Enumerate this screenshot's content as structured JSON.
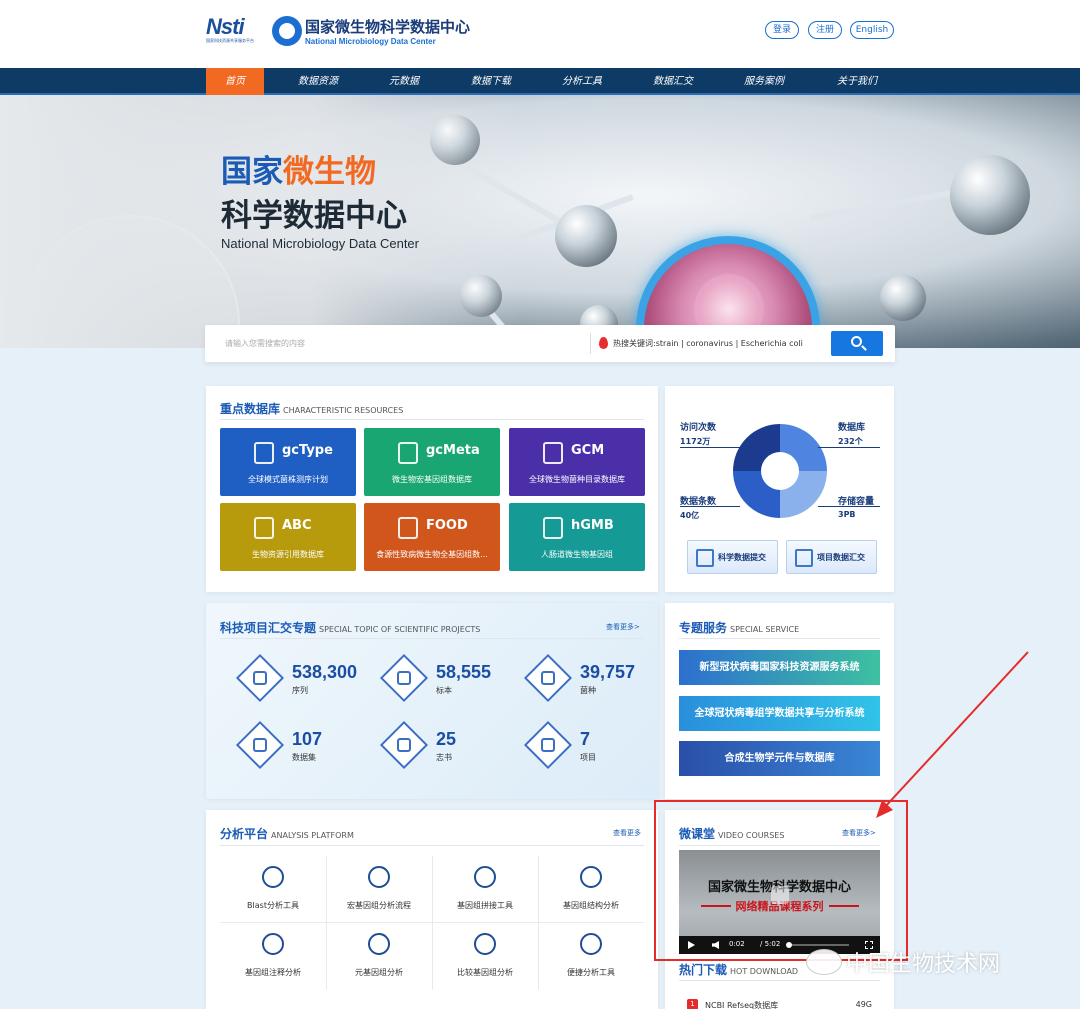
{
  "header": {
    "logo_text": "Nsti",
    "logo_sub": "国家科技资源共享服务平台",
    "title": "国家微生物科学数据中心",
    "subtitle": "National Microbiology Data Center",
    "buttons": {
      "login": "登录",
      "register": "注册",
      "english": "English"
    }
  },
  "nav": {
    "items": [
      "首页",
      "数据资源",
      "元数据",
      "数据下载",
      "分析工具",
      "数据汇交",
      "服务案例",
      "关于我们"
    ],
    "active": "首页"
  },
  "banner": {
    "title_part1": "国家",
    "title_highlight": "微生物",
    "title_line2": "科学数据中心",
    "title_en": "National  Microbiology Data Center"
  },
  "search": {
    "placeholder": "请输入您需搜索的内容",
    "hot_keywords": "热搜关键词:strain | coronavirus | Escherichia coli"
  },
  "resources": {
    "title": "重点数据库",
    "title_en": "CHARACTERISTIC RESOURCES",
    "tiles": [
      {
        "name": "gcType",
        "desc": "全球模式菌株测序计划",
        "icon": "flask-icon",
        "color": "#1f5fc4"
      },
      {
        "name": "gcMeta",
        "desc": "微生物宏基因组数据库",
        "icon": "molecule-icon",
        "color": "#1aa673"
      },
      {
        "name": "GCM",
        "desc": "全球微生物菌种目录数据库",
        "icon": "virus-icon",
        "color": "#4a2fa8"
      },
      {
        "name": "ABC",
        "desc": "生物资源引用数据库",
        "icon": "chart-icon",
        "color": "#b89a0d"
      },
      {
        "name": "FOOD",
        "desc": "食源性致病微生物全基因组数...",
        "icon": "gear-icon",
        "color": "#d0561c"
      },
      {
        "name": "hGMB",
        "desc": "人肠道微生物基因组",
        "icon": "bacteria-icon",
        "color": "#159a96"
      }
    ]
  },
  "stats": {
    "visits_label": "访问次数",
    "visits_value": "1172万",
    "databases_label": "数据库",
    "databases_value": "232个",
    "records_label": "数据条数",
    "records_value": "40亿",
    "storage_label": "存储容量",
    "storage_value": "3PB",
    "btn_submit": "科学数据提交",
    "btn_project": "项目数据汇交"
  },
  "projects": {
    "title": "科技项目汇交专题",
    "title_en": "SPECIAL TOPIC OF SCIENTIFIC PROJECTS",
    "more": "查看更多>",
    "items": [
      {
        "value": "538,300",
        "label": "序列",
        "icon": "list-icon"
      },
      {
        "value": "58,555",
        "label": "标本",
        "icon": "flask-icon"
      },
      {
        "value": "39,757",
        "label": "菌种",
        "icon": "bacteria-icon"
      },
      {
        "value": "107",
        "label": "数据集",
        "icon": "database-icon"
      },
      {
        "value": "25",
        "label": "志书",
        "icon": "book-icon"
      },
      {
        "value": "7",
        "label": "项目",
        "icon": "document-icon"
      }
    ]
  },
  "special_service": {
    "title": "专题服务",
    "title_en": "SPECIAL SERVICE",
    "items": [
      {
        "label": "新型冠状病毒国家科技资源服务系统",
        "color": "#2d6fd0"
      },
      {
        "label": "全球冠状病毒组学数据共享与分析系统",
        "color": "#27a7e0"
      },
      {
        "label": "合成生物学元件与数据库",
        "color": "#2a55b0"
      }
    ]
  },
  "analysis": {
    "title": "分析平台",
    "title_en": "ANALYSIS PLATFORM",
    "more": "查看更多",
    "tools": [
      {
        "label": "Blast分析工具",
        "icon": "dna-search-icon"
      },
      {
        "label": "宏基因组分析流程",
        "icon": "petri-dish-icon"
      },
      {
        "label": "基因组拼接工具",
        "icon": "molecule-icon"
      },
      {
        "label": "基因组结构分析",
        "icon": "flask-icon"
      },
      {
        "label": "基因组注释分析",
        "icon": "virus-icon"
      },
      {
        "label": "元基因组分析",
        "icon": "cells-icon"
      },
      {
        "label": "比较基因组分析",
        "icon": "bacteria-icon"
      },
      {
        "label": "便捷分析工具",
        "icon": "tools-icon"
      }
    ]
  },
  "video": {
    "title": "微课堂",
    "title_en": "VIDEO COURSES",
    "more": "查看更多>",
    "screen_title": "国家微生物科学数据中心",
    "screen_subtitle": "网络精品课程系列",
    "current_time": "0:02",
    "duration": "/ 5:02",
    "progress": 0.01
  },
  "hot_download": {
    "title": "热门下载",
    "title_en": "HOT DOWNLOAD",
    "items": [
      {
        "rank": "1",
        "name": "NCBI Refseq数据库",
        "size": "49G"
      }
    ]
  },
  "watermark": "中国生物技术网",
  "annotation_color": "#e52b2b"
}
